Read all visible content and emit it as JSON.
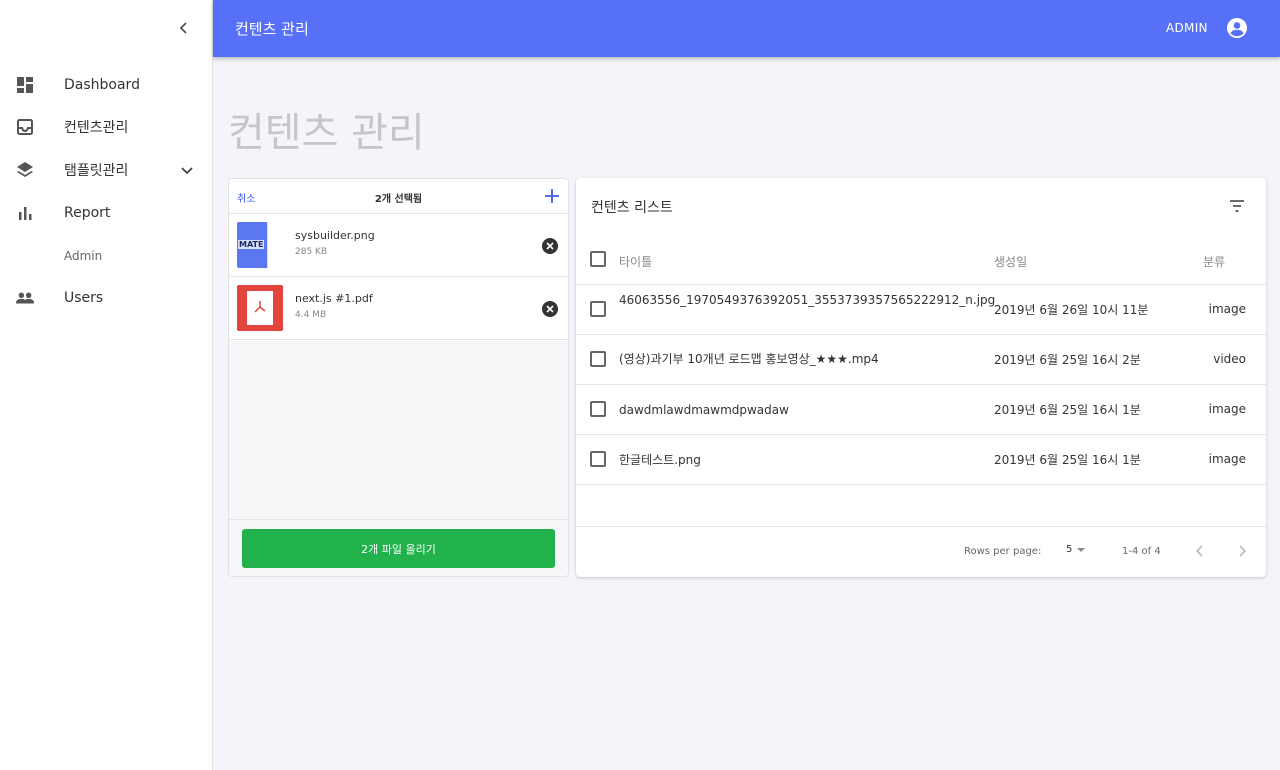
{
  "header": {
    "title": "컨텐츠 관리",
    "user": "ADMIN"
  },
  "sidebar": {
    "items": [
      {
        "label": "Dashboard",
        "icon": "dashboard-icon"
      },
      {
        "label": "컨텐츠관리",
        "icon": "inbox-icon"
      },
      {
        "label": "탬플릿관리",
        "icon": "layers-icon"
      },
      {
        "label": "Report",
        "icon": "bar-chart-icon"
      },
      {
        "label": "Admin"
      },
      {
        "label": "Users",
        "icon": "people-icon"
      }
    ]
  },
  "page": {
    "title": "컨텐츠 관리"
  },
  "upload": {
    "cancel": "취소",
    "selected": "2개 선택됨",
    "files": [
      {
        "name": "sysbuilder.png",
        "size": "285 KB",
        "thumb_text": "MATE"
      },
      {
        "name": "next.js #1.pdf",
        "size": "4.4 MB"
      }
    ],
    "button": "2개 파일 올리기",
    "colors": {
      "button": "#21b24b"
    }
  },
  "list": {
    "title": "컨텐츠 리스트",
    "headers": {
      "title": "타이틀",
      "created": "생성일",
      "type": "분류"
    },
    "rows": [
      {
        "title": "46063556_1970549376392051_3553739357565222912_n.jpg",
        "created": "2019년 6월 26일 10시 11분",
        "type": "image"
      },
      {
        "title": "(영상)과기부 10개년 로드맵 홍보영상_★★★.mp4",
        "created": "2019년 6월 25일 16시 2분",
        "type": "video"
      },
      {
        "title": "dawdmlawdmawmdpwadaw",
        "created": "2019년 6월 25일 16시 1분",
        "type": "image"
      },
      {
        "title": "한글테스트.png",
        "created": "2019년 6월 25일 16시 1분",
        "type": "image"
      }
    ],
    "footer": {
      "rows_per_page_label": "Rows per page:",
      "rows_per_page": "5",
      "range": "1-4 of 4"
    }
  },
  "colors": {
    "header": "#5670f7",
    "accent": "#3b59f1"
  }
}
